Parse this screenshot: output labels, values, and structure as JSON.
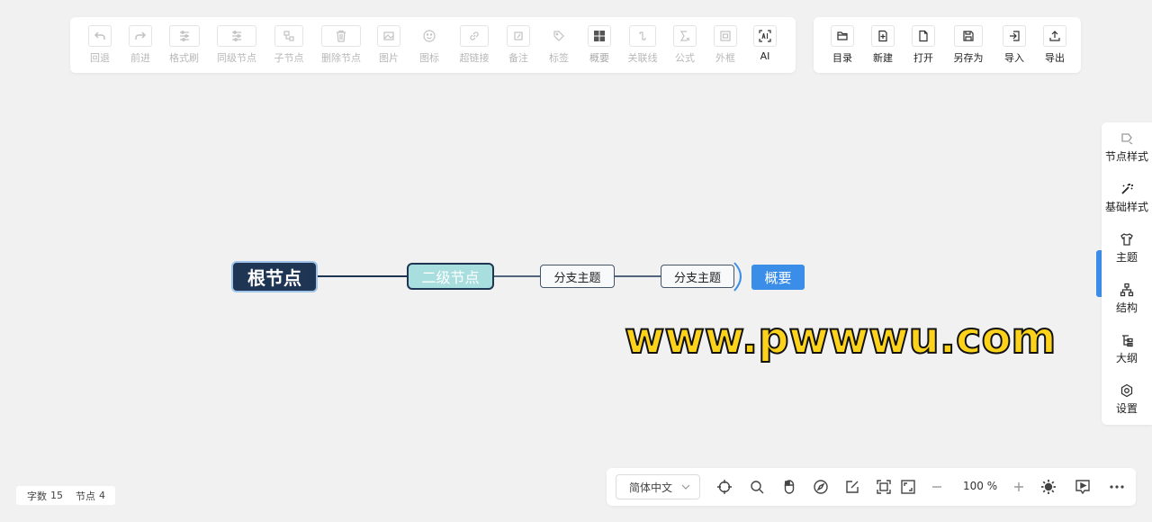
{
  "main_toolbar": {
    "items": [
      {
        "label": "回退",
        "icon": "undo-icon"
      },
      {
        "label": "前进",
        "icon": "redo-icon"
      },
      {
        "label": "格式刷",
        "icon": "format-brush-icon"
      },
      {
        "label": "同级节点",
        "icon": "sibling-node-icon"
      },
      {
        "label": "子节点",
        "icon": "child-node-icon"
      },
      {
        "label": "删除节点",
        "icon": "trash-icon"
      },
      {
        "label": "图片",
        "icon": "image-icon"
      },
      {
        "label": "图标",
        "icon": "smiley-icon"
      },
      {
        "label": "超链接",
        "icon": "link-icon"
      },
      {
        "label": "备注",
        "icon": "note-icon"
      },
      {
        "label": "标签",
        "icon": "tag-icon"
      },
      {
        "label": "概要",
        "icon": "summary-icon"
      },
      {
        "label": "关联线",
        "icon": "association-line-icon"
      },
      {
        "label": "公式",
        "icon": "formula-icon"
      },
      {
        "label": "外框",
        "icon": "outer-frame-icon"
      },
      {
        "label": "AI",
        "icon": "ai-icon"
      }
    ]
  },
  "file_toolbar": {
    "items": [
      {
        "label": "目录",
        "icon": "folder-icon"
      },
      {
        "label": "新建",
        "icon": "new-file-icon"
      },
      {
        "label": "打开",
        "icon": "file-icon"
      },
      {
        "label": "另存为",
        "icon": "save-as-icon"
      },
      {
        "label": "导入",
        "icon": "import-icon"
      },
      {
        "label": "导出",
        "icon": "export-icon"
      }
    ]
  },
  "side_panel": {
    "items": [
      {
        "label": "节点样式",
        "icon": "node-style-icon"
      },
      {
        "label": "基础样式",
        "icon": "magic-wand-icon"
      },
      {
        "label": "主题",
        "icon": "shirt-icon"
      },
      {
        "label": "结构",
        "icon": "structure-icon"
      },
      {
        "label": "大纲",
        "icon": "outline-icon"
      },
      {
        "label": "设置",
        "icon": "settings-icon"
      }
    ]
  },
  "mindmap": {
    "root": "根节点",
    "second": "二级节点",
    "branch1": "分支主题",
    "branch2": "分支主题",
    "summary": "概要"
  },
  "watermark": "www.pwwwu.com",
  "status": {
    "word_label": "字数",
    "word_count": "15",
    "node_label": "节点",
    "node_count": "4"
  },
  "bottom_bar": {
    "language": "简体中文",
    "zoom": "100 %"
  },
  "colors": {
    "root_fill": "#1e3554",
    "second_fill": "#a9dede",
    "summary_fill": "#3b8ee8",
    "accent": "#3b8ee8",
    "watermark_fill": "#fcd21b"
  }
}
